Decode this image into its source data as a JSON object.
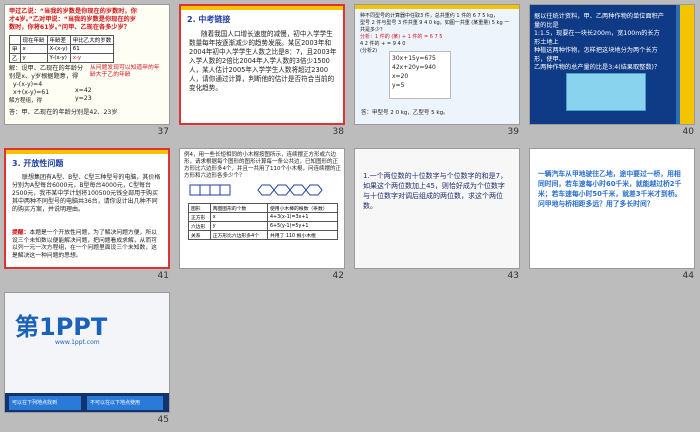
{
  "slides": [
    {
      "num": "37",
      "lines": [
        "甲过乙说：“当我的岁数是你现在的岁数时，你",
        "才4岁。”乙对甲说：“当我的岁数是你现在的岁",
        "数时，你将61岁。”问甲、乙现在各多少岁？"
      ],
      "table_header": [
        "现在年龄",
        "年龄差",
        "甲比乙大的岁数"
      ],
      "table_rows": [
        [
          "甲",
          "x",
          "X-(x-y)",
          "61"
        ],
        [
          "乙",
          "y",
          "Y-(x-y)",
          "x-y"
        ]
      ],
      "body": [
        "解：设甲、乙现在的年龄分",
        "别是x、y岁根据题意，得",
        "y-(x-y)=4",
        "x+(x-y)=61",
        "解方程组，得",
        "x=42",
        "y=23",
        "答：甲、乙现在的年龄分别是42、23岁"
      ],
      "note": "从问题发现可以知道甲的年龄大于乙的年龄"
    },
    {
      "num": "38",
      "title": "2. 中考链接",
      "body": "随着我国人口增长速度的减慢，初中入学学生数量每年按逐渐减少的趋势发展。某区2003年和2004年初中入学学生人数之比是8：7，且2003年入学人数的2倍比2004年入学人数的3倍少1500人，某人估计2005年入学学生人数将超过2300人，请你通过计算，判断他的估计是否符合当前的变化趋势。"
    },
    {
      "num": "39",
      "lines": [
        "种不同型号的计算器中任取3 件，总共重约 1 件的 6 7 5 kg，",
        "型号 2 件与型号 3 件共重 9 4 0 kg。如图一共重 (某重量) 5 kg 一共是多少？",
        "分析：1 件的 (某) + 1 件的 = 6 7 5",
        "4 2 件的 +  = 9 4 0",
        "(分析2)"
      ],
      "system": [
        "30x+15y=675",
        "42x+20y=940",
        "x=20",
        "y=5"
      ],
      "footer": "答：甲型号 2 0 kg，乙型号 5 kg。"
    },
    {
      "num": "40",
      "lines": [
        "据以往统计资料，甲、乙两种作物的单位面积产量的比是",
        "1:1.5，现要在一块长200m，宽100m的长方形土地上",
        "种植这两种作物，怎样把这块地分为两个长方形，使甲、",
        "乙两种作物的总产量的比是3:4(结果取整数)？"
      ]
    },
    {
      "num": "41",
      "title": "3. 开放性问题",
      "body": "联想集团有A型、B型、C型三种型号的电脑，其价格分别为A型每台6000元，B型每台4000元，C型每台2500元，我市某中学计划将100500元钱全部用于购买其中两种不同型号的电脑共36台，请你设计出几种不同的购买方案，并说明理由。",
      "hint_title": "提醒：",
      "hint": "本题是一个开放性问题，为了解决问题方便，所以设三个未知数以便能解决问题，把问题看成求解，从而可以列一元一次方程组，在一个问题里面设三个未知数，这是解决这一种问题的思想。"
    },
    {
      "num": "42",
      "title": "例4，用一些长短相同的小木棍按图所示，连续摆正方形或六边形，请求根据每个图形的图形计算每一条公共边，已知图形的正方形比六边形多4个，并且一共用了110个小木棍，问连续摆的正方形和六边形各多少个？",
      "table_header": [
        "图形",
        "两图图形的个数",
        "使用小木棒的根数（条数）"
      ],
      "table_rows": [
        [
          "正方形",
          "x",
          "4+3(x-1)=3x+1"
        ],
        [
          "六边形",
          "y",
          "6+5(y-1)=5y+1"
        ],
        [
          "关系",
          "正方形比六边形多4个",
          "共用了 110 根小木棍"
        ]
      ]
    },
    {
      "num": "43",
      "body": "1.一个两位数的十位数字与个位数字的和是7，如果这个两位数加上45，则恰好成为个位数字与十位数字对调后组成的两位数，求这个两位数。"
    },
    {
      "num": "44",
      "body": "一辆汽车从甲地驶往乙地，途中要过一桥，用相同时间，若车速每小时60千米，就能越过桥2千米；若车速每小时50千米，就差3千米才到桥。问甲地与桥相距多远？用了多长时间？"
    },
    {
      "num": "45",
      "logo_text": "第1PPT",
      "logo_sub": "www.1ppt.com",
      "foot": [
        "可以在下列地点找到",
        "不可以在以下地点使用"
      ]
    }
  ],
  "colors": {
    "yellow": "#f5c400",
    "blue": "#2e6fb8",
    "red": "#d0151b",
    "navy": "#14336e"
  }
}
